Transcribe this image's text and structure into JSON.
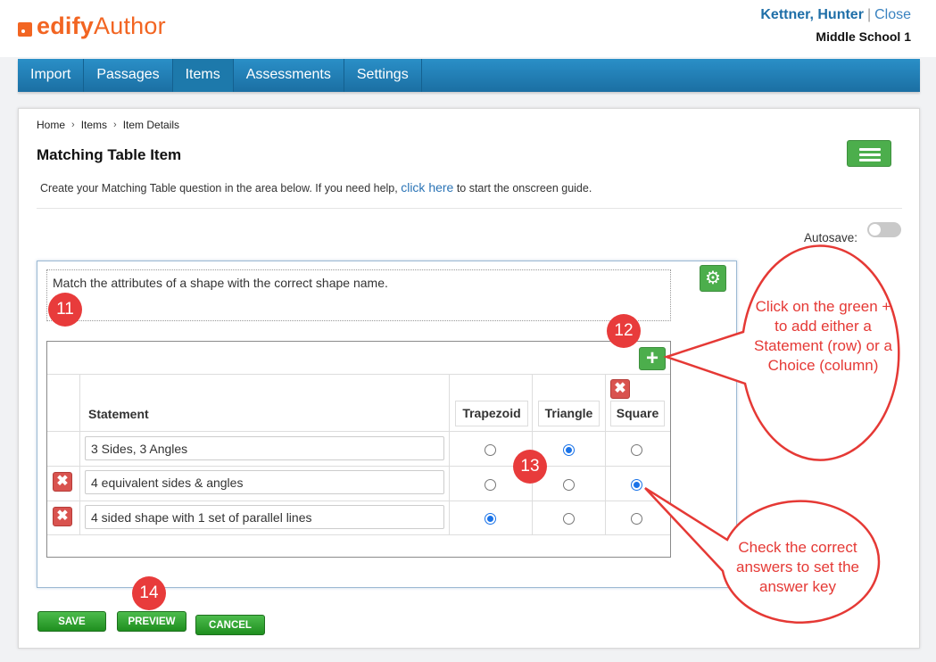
{
  "app": {
    "brand_part1": "edify",
    "brand_part2": "Author"
  },
  "user": {
    "name": "Kettner, Hunter",
    "separator": "|",
    "close_label": "Close",
    "school": "Middle School 1"
  },
  "nav": {
    "tabs": [
      {
        "label": "Import",
        "active": false
      },
      {
        "label": "Passages",
        "active": false
      },
      {
        "label": "Items",
        "active": true
      },
      {
        "label": "Assessments",
        "active": false
      },
      {
        "label": "Settings",
        "active": false
      }
    ]
  },
  "breadcrumb": [
    "Home",
    "Items",
    "Item Details"
  ],
  "page": {
    "title": "Matching Table Item",
    "intro_before": "Create your Matching Table question in the area below. If you need help, ",
    "intro_link": "click here",
    "intro_after": " to start the onscreen guide."
  },
  "autosave": {
    "label": "Autosave:",
    "enabled": false
  },
  "question": {
    "text": "Match the attributes of a shape with the correct shape name."
  },
  "table": {
    "statement_header": "Statement",
    "choices": [
      "Trapezoid",
      "Triangle",
      "Square"
    ],
    "rows": [
      {
        "statement": "3 Sides, 3 Angles",
        "deletable": false,
        "selected": 1
      },
      {
        "statement": "4 equivalent sides & angles",
        "deletable": true,
        "selected": 2
      },
      {
        "statement": "4 sided shape with 1 set of parallel lines",
        "deletable": true,
        "selected": 0
      }
    ]
  },
  "buttons": {
    "save": "SAVE",
    "preview": "PREVIEW",
    "cancel": "CANCEL"
  },
  "annotations": {
    "badges": [
      "11",
      "12",
      "13",
      "14"
    ],
    "callout_add": "Click on the green + to add either a Statement (row) or a Choice (column)",
    "callout_check": "Check the correct answers to set the answer key"
  },
  "icons": {
    "menu": "hamburger-icon",
    "settings": "gear-icon",
    "add": "plus-icon",
    "delete": "close-icon",
    "breadcrumb_sep": "chevron-right-icon"
  },
  "colors": {
    "brand": "#f26522",
    "nav": "#1b6fa3",
    "green": "#4cae4c",
    "delete": "#d9534f",
    "annotation": "#e53935",
    "link": "#2b74b6"
  }
}
